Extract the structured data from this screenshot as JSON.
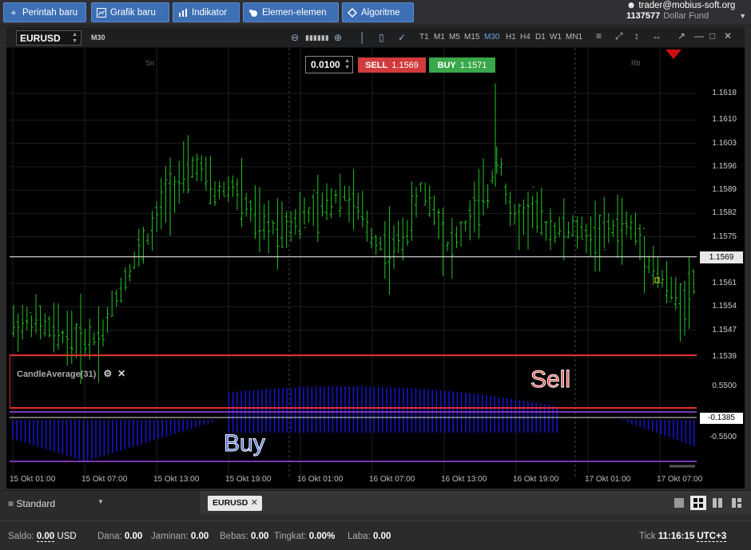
{
  "toolbar": {
    "buttons": [
      {
        "label": "Perintah baru",
        "icon": "plus-icon"
      },
      {
        "label": "Grafik baru",
        "icon": "chart-icon"
      },
      {
        "label": "Indikator",
        "icon": "bars-icon"
      },
      {
        "label": "Elemen-elemen",
        "icon": "shapes-icon"
      },
      {
        "label": "Algoritme",
        "icon": "diamond-icon"
      }
    ],
    "account": {
      "user": "trader@mobius-soft.org",
      "number": "1137577",
      "fund": "Dollar Fund"
    }
  },
  "chart": {
    "symbol": "EURUSD",
    "timeframe_badge": "M30",
    "timeframes": [
      "T1",
      "M1",
      "M5",
      "M15",
      "M30",
      "H1",
      "H4",
      "D1",
      "W1",
      "MN1"
    ],
    "active_timeframe": "M30",
    "lot": "0.0100",
    "sell": {
      "label": "SELL",
      "price": "1.1569"
    },
    "buy": {
      "label": "BUY",
      "price": "1.1571"
    },
    "day_markers": [
      "Sn",
      "Rb"
    ],
    "price_ticks": [
      "1.1618",
      "1.1610",
      "1.1603",
      "1.1596",
      "1.1589",
      "1.1582",
      "1.1575",
      "1.1561",
      "1.1554",
      "1.1547",
      "1.1539"
    ],
    "current_price": "1.1569",
    "indicator": {
      "name": "CandleAverage(31)",
      "upper_tick": "0.5500",
      "current_value": "-0.1385",
      "lower_tick": "-0.5500"
    },
    "annotations": {
      "sell": "Sell",
      "buy": "Buy"
    },
    "time_labels": [
      "15 Okt 01:00",
      "15 Okt 07:00",
      "15 Okt 13:00",
      "15 Okt 19:00",
      "16 Okt 01:00",
      "16 Okt 07:00",
      "16 Okt 13:00",
      "16 Okt 19:00",
      "17 Okt 01:00",
      "17 Okt 07:00"
    ],
    "colors": {
      "candle": "#22c422",
      "histogram": "#1515c8",
      "sell_box": "#e03030",
      "buy_box": "#7a38b8",
      "price_line": "#e0e0e0"
    }
  },
  "tabs": {
    "workspace": "Standard",
    "open_tab": "EURUSD"
  },
  "status": {
    "saldo_label": "Saldo:",
    "saldo_value": "0.00",
    "saldo_ccy": "USD",
    "dana_label": "Dana:",
    "dana_value": "0.00",
    "jaminan_label": "Jaminan:",
    "jaminan_value": "0.00",
    "bebas_label": "Bebas:",
    "bebas_value": "0.00",
    "tingkat_label": "Tingkat:",
    "tingkat_value": "0.00%",
    "laba_label": "Laba:",
    "laba_value": "0.00",
    "tick_label": "Tick",
    "time": "11:16:15",
    "tz": "UTC+3"
  }
}
